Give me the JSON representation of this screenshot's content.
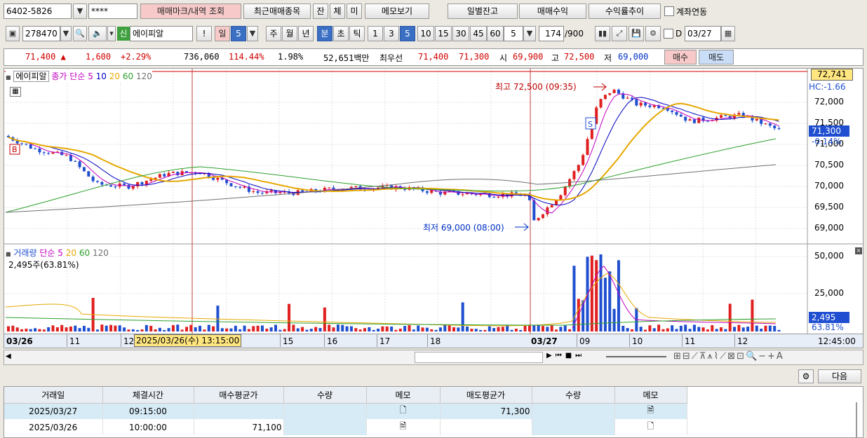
{
  "toolbar1": {
    "account": "6402-5826",
    "password": "****",
    "btn_mark": "매매마크/내역 조회",
    "btn_recent": "최근매매종목",
    "btn_jan": "잔",
    "btn_che": "체",
    "btn_mi": "미",
    "btn_memo": "메모보기",
    "btn_daily": "일별잔고",
    "btn_profit": "매매수익",
    "btn_rate": "수익률추이",
    "chk_link_label": "계좌연동"
  },
  "toolbar2": {
    "code": "278470",
    "credit_badge": "신",
    "name": "에이피알",
    "btn_excl": "!",
    "period_day": "일",
    "period_day_n": "5",
    "period_week": "주",
    "period_month": "월",
    "period_year": "년",
    "period_min": "분",
    "period_sec": "초",
    "period_tick": "틱",
    "minutes": [
      "1",
      "3",
      "5",
      "10",
      "15",
      "30",
      "45",
      "60"
    ],
    "minute_selected": "5",
    "count_sel": "5",
    "bars": "174",
    "bars_total": "/900",
    "chk_d_label": "D",
    "date": "03/27"
  },
  "quote": {
    "price": "71,400 ▲",
    "change": "1,600",
    "change_pct": "+2.29%",
    "volume": "736,060",
    "vol_ratio": "114.44%",
    "turnover": "1.98%",
    "amount": "52,651백만",
    "best_label": "최우선",
    "best_ask": "71,400",
    "best_bid": "71,300",
    "open_label": "시",
    "open": "69,900",
    "high_label": "고",
    "high": "72,500",
    "low_label": "저",
    "low": "69,000",
    "buy_label": "매수",
    "sell_label": "매도"
  },
  "chart": {
    "legend_price": "에이피알",
    "legend_ma": "종가 단순",
    "ma_periods": [
      "5",
      "10",
      "20",
      "60",
      "120"
    ],
    "high_note": "최고 72,500 (09:35)",
    "low_note": "최저 69,000 (08:00)",
    "price_ticks": [
      "72,000",
      "71,500",
      "71,000",
      "70,500",
      "70,000",
      "69,500",
      "69,000"
    ],
    "price_top_badge": "72,741",
    "hc_label": "HC:-1.66",
    "cur_price_badge": "71,300",
    "cur_pct": "-0.14%",
    "buy_marker": "B",
    "sell_marker": "S",
    "vol_legend": "거래량",
    "vol_ma_legend": "단순",
    "vol_ma_periods": [
      "5",
      "20",
      "60",
      "120"
    ],
    "vol_info": "2,495주(63.81%)",
    "vol_ticks": [
      "50,000",
      "25,000"
    ],
    "vol_badge": "2,495",
    "vol_pct": "63.81%",
    "x_labels": [
      "03/26",
      "11",
      "12",
      "15",
      "16",
      "17",
      "18",
      "03/27",
      "09",
      "10",
      "11",
      "12"
    ],
    "cursor_label": "2025/03/26(수) 13:15:00",
    "time_right": "12:45:00",
    "colors": {
      "up": "#e02020",
      "down": "#1f4fd0",
      "ma5": "#c000c0",
      "ma10": "#0000c0",
      "ma20": "#e6a800",
      "ma60": "#2ca02c",
      "ma120": "#707070"
    }
  },
  "bottom": {
    "next_label": "다음",
    "headers": [
      "거래일",
      "체결시간",
      "매수평균가",
      "수량",
      "메모",
      "매도평균가",
      "수량",
      "메모"
    ],
    "rows": [
      [
        "2025/03/27",
        "09:15:00",
        "",
        "",
        "",
        "71,300",
        "",
        ""
      ],
      [
        "2025/03/26",
        "10:00:00",
        "71,100",
        "",
        "",
        "",
        "",
        ""
      ]
    ]
  }
}
